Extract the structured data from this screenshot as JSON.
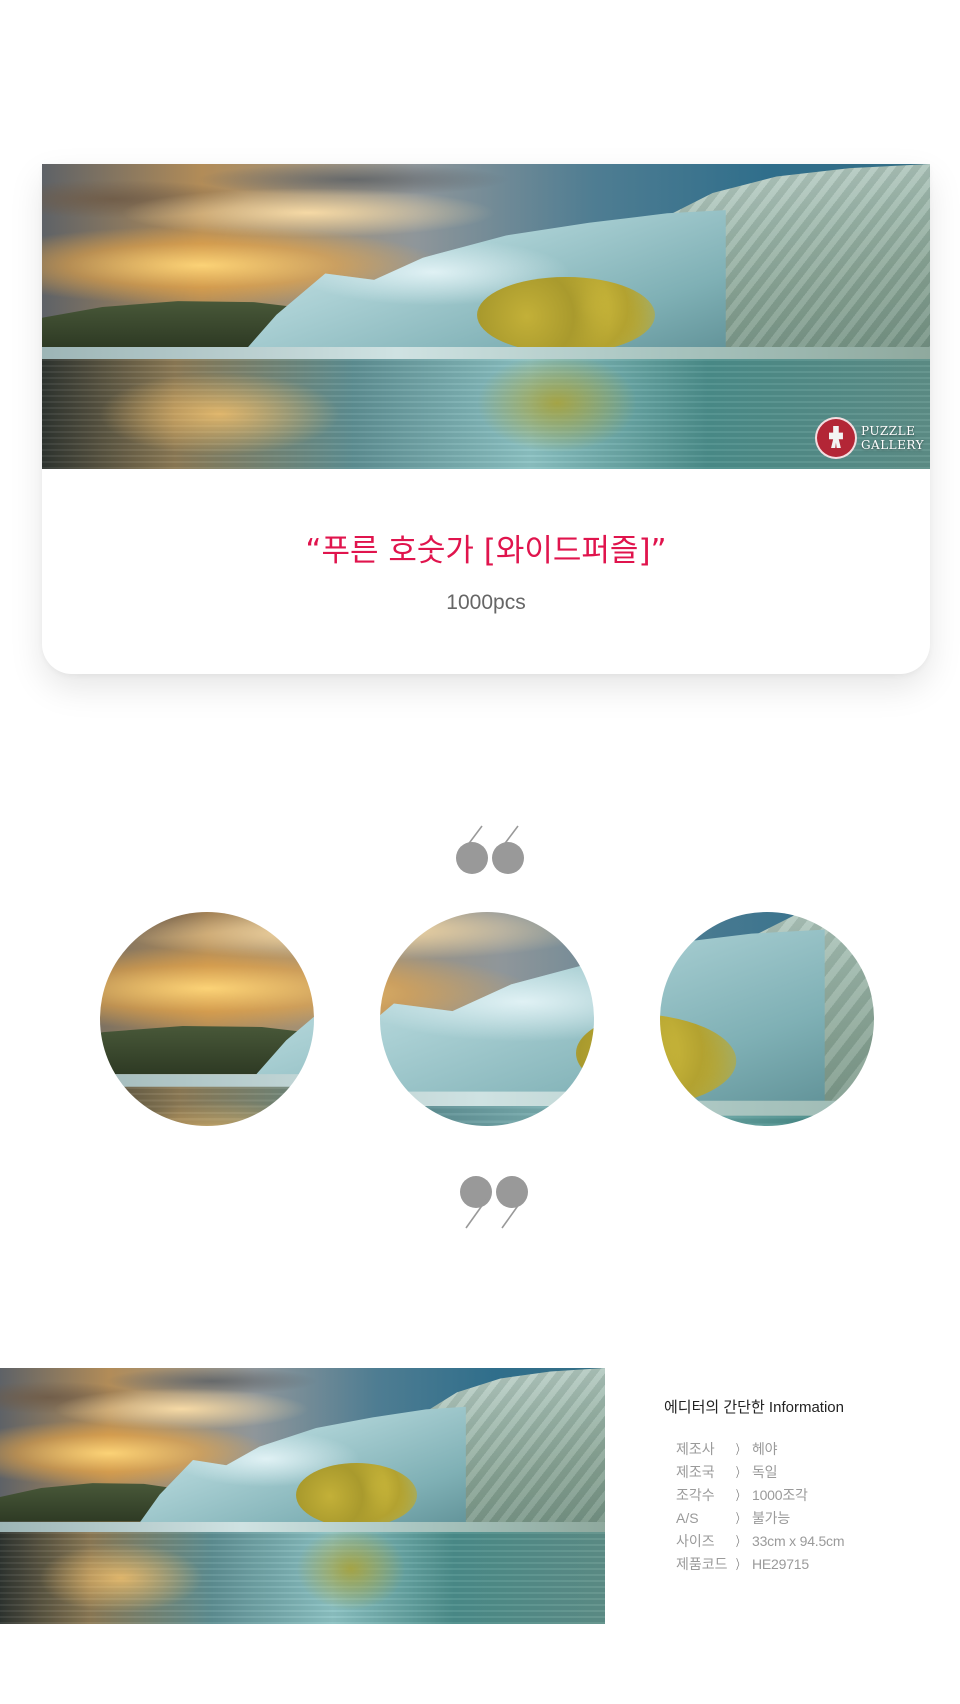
{
  "product": {
    "title": "“푸른 호숫가 [와이드퍼즐]”",
    "pieces": "1000pcs"
  },
  "logo": {
    "line1": "PUZZLE",
    "line2": "GALLERY"
  },
  "quote_open_icon": "open-quote-icon",
  "quote_close_icon": "close-quote-icon",
  "info": {
    "title": "에디터의 간단한 Information",
    "rows": [
      {
        "label": "제조사",
        "value": "헤야"
      },
      {
        "label": "제조국",
        "value": "독일"
      },
      {
        "label": "조각수",
        "value": "1000조각"
      },
      {
        "label": "A/S",
        "value": "불가능"
      },
      {
        "label": "사이즈",
        "value": "33cm x 94.5cm"
      },
      {
        "label": "제품코드",
        "value": "HE29715"
      }
    ],
    "arrow": "〉"
  },
  "colors": {
    "title": "#e0144d",
    "quote": "#999999",
    "logo_red": "#b32636"
  }
}
